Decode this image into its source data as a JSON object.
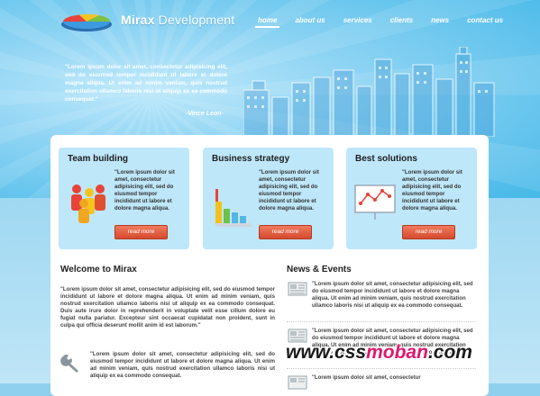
{
  "logo": {
    "name": "Mirax",
    "suffix": " Development"
  },
  "nav": [
    "home",
    "about us",
    "services",
    "clients",
    "news",
    "contact us"
  ],
  "hero": {
    "quote": "\"Lorem ipsum dolor sit amet, consectetur adipisicing elit, sed do eiusmod tempor incididunt ut labore et dolore magna aliqua. Ut enim ad minim veniam, quis nostrud exercitation ullamco laboris nisi ut aliquip ex ea commodo consequat.\"",
    "author": "-Vince Leon-"
  },
  "boxes": [
    {
      "title": "Team building",
      "text": "\"Lorem ipsum dolor sit amet, consectetur adipisicing elit, sed do eiusmod tempor incididunt ut labore et dolore magna aliqua.",
      "button": "read more",
      "icon": "team-people-icon"
    },
    {
      "title": "Business strategy",
      "text": "\"Lorem ipsum dolor sit amet, consectetur adipisicing elit, sed do eiusmod tempor incididunt ut labore et dolore magna aliqua.",
      "button": "read more",
      "icon": "bar-chart-icon"
    },
    {
      "title": "Best solutions",
      "text": "\"Lorem ipsum dolor sit amet, consectetur adipisicing elit, sed do eiusmod tempor incididunt ut labore et dolore magna aliqua.",
      "button": "read more",
      "icon": "presentation-board-icon"
    }
  ],
  "welcome": {
    "title": "Welcome to Mirax",
    "para1": "\"Lorem ipsum dolor sit amet, consectetur adipisicing elit, sed do eiusmod tempor incididunt ut labore et dolore magna aliqua. Ut enim ad minim veniam, quis nostrud exercitation ullamco laboris nisi ut aliquip ex ea commodo consequat. Duis aute irure dolor in reprehenderit in voluptate velit esse cillum dolore eu fugiat nulla pariatur. Excepteur sint occaecat cupidatat non proident, sunt in culpa qui officia deserunt mollit anim id est laborum.\"",
    "para2": "\"Lorem ipsum dolor sit amet, consectetur adipisicing elit, sed do eiusmod tempor incididunt ut labore et dolore magna aliqua. Ut enim ad minim veniam, quis nostrud exercitation ullamco laboris nisi ut aliquip ex ea commodo consequat."
  },
  "news": {
    "title": "News & Events",
    "items": [
      "\"Lorem ipsum dolor sit amet, consectetur adipisicing elit, sed do eiusmod tempor incididunt ut labore et dolore magna aliqua. Ut enim ad minim veniam, quis nostrud exercitation ullamco laboris nisi ut aliquip ex ea commodo consequat.",
      "\"Lorem ipsum dolor sit amet, consectetur adipisicing elit, sed do eiusmod tempor incididunt ut labore et dolore magna aliqua. Ut enim ad minim veniam, quis nostrud exercitation ullamco laboris nisi ut aliquip ex ea commodo consequat.",
      "\"Lorem ipsum dolor sit amet, consectetur"
    ]
  },
  "watermark": {
    "pre": "www.css",
    "mid": "moban",
    "post": ".com"
  },
  "colors": {
    "accent": "#d44a2d",
    "sky": "#45b8e8",
    "box": "#bfe7fa"
  }
}
